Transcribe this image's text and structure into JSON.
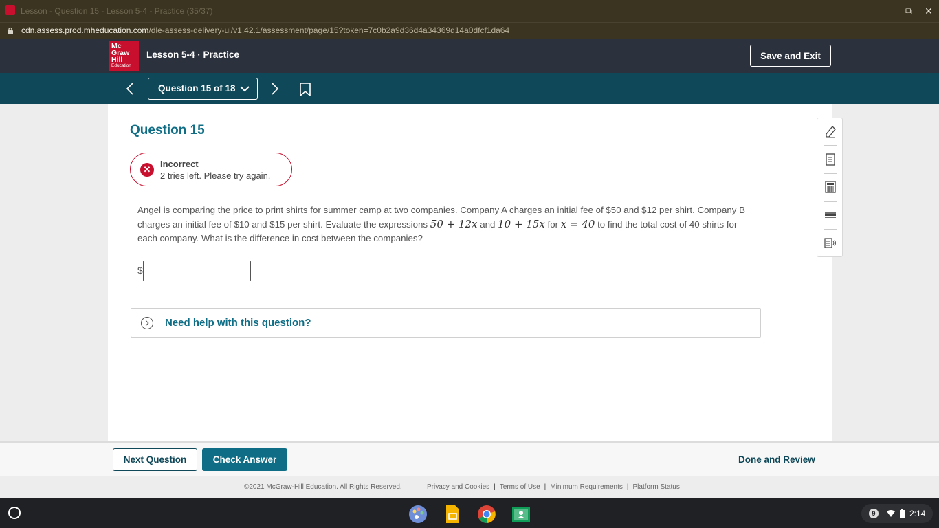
{
  "window": {
    "title": "Lesson - Question 15 - Lesson 5-4 - Practice (35/37)"
  },
  "address_bar": {
    "host": "cdn.assess.prod.mheducation.com",
    "path": "/dle-assess-delivery-ui/v1.42.1/assessment/page/15?token=7c0b2a9d36d4a34369d14a0dfcf1da64"
  },
  "header": {
    "logo_lines": [
      "Mc",
      "Graw",
      "Hill"
    ],
    "logo_sub": "Education",
    "lesson_title": "Lesson 5-4 · Practice",
    "save_exit": "Save and Exit"
  },
  "question_nav": {
    "selector": "Question 15 of 18"
  },
  "question": {
    "heading": "Question 15",
    "feedback_title": "Incorrect",
    "feedback_message": "2 tries left. Please try again.",
    "prompt_part1": "Angel is comparing the price to print shirts for summer camp at two companies. Company A charges an initial fee of $50 and $12 per shirt. Company B charges an initial fee of $10 and $15 per shirt. Evaluate the expressions ",
    "expr_a": "50 + 12x",
    "prompt_and": " and ",
    "expr_b": "10 + 15x",
    "prompt_for": " for ",
    "expr_x": "x = 40",
    "prompt_part2": " to find the total cost of 40 shirts for each company. What is the difference in cost between the companies?",
    "currency_symbol": "$",
    "answer_value": "",
    "help_label": "Need help with this question?"
  },
  "actions": {
    "next_question": "Next Question",
    "check_answer": "Check Answer",
    "done_review": "Done and Review"
  },
  "footer": {
    "copyright": "©2021 McGraw-Hill Education. All Rights Reserved.",
    "links": [
      "Privacy and Cookies",
      "Terms of Use",
      "Minimum Requirements",
      "Platform Status"
    ]
  },
  "taskbar": {
    "notification_count": "9",
    "time": "2:14"
  },
  "colors": {
    "brand_red": "#c8102e",
    "nav_teal": "#0e4859",
    "accent_teal": "#0f6e86",
    "header_dark": "#2b313d"
  }
}
